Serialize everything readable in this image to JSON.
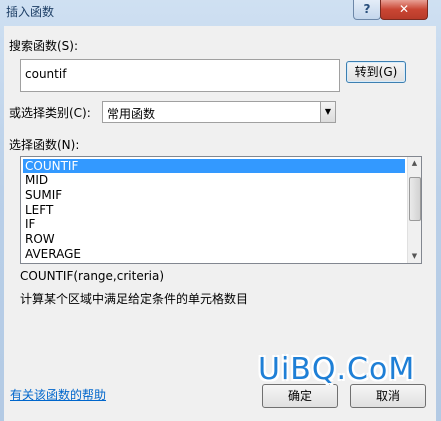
{
  "window": {
    "title": "插入函数",
    "help_glyph": "?",
    "close_glyph": "✕"
  },
  "search": {
    "label": "搜索函数(S):",
    "value": "countif",
    "go_button": "转到(G)"
  },
  "category": {
    "label": "或选择类别(C):",
    "value": "常用函数",
    "arrow_glyph": "▼"
  },
  "functions": {
    "label": "选择函数(N):",
    "items": [
      "COUNTIF",
      "MID",
      "SUMIF",
      "LEFT",
      "IF",
      "ROW",
      "AVERAGE"
    ],
    "selected_index": 0
  },
  "signature": "COUNTIF(range,criteria)",
  "description": "计算某个区域中满足给定条件的单元格数目",
  "help_link": "有关该函数的帮助",
  "buttons": {
    "ok": "确定",
    "cancel": "取消"
  },
  "watermark": "UiBQ.CoM",
  "icons": {
    "scroll_up": "▲",
    "scroll_down": "▼"
  }
}
